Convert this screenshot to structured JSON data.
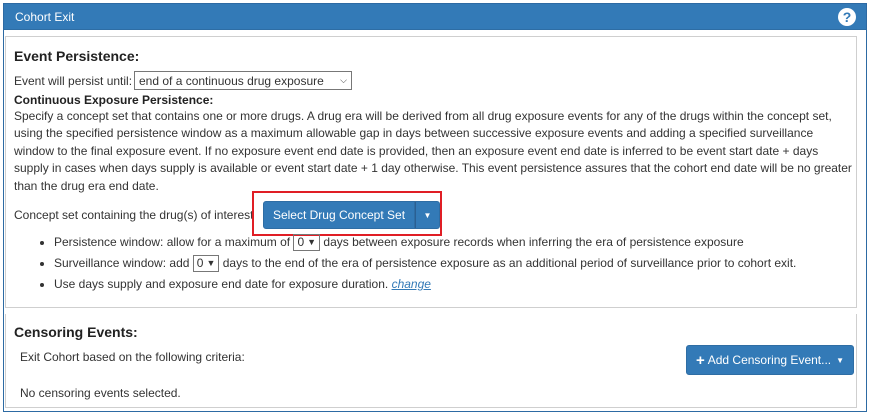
{
  "panel": {
    "title": "Cohort Exit",
    "help_icon": "question-circle-icon"
  },
  "persistence": {
    "heading": "Event Persistence:",
    "persist_label": "Event will persist until:",
    "persist_select": "end of a continuous drug exposure",
    "sub_heading": "Continuous Exposure Persistence:",
    "description": "Specify a concept set that contains one or more drugs. A drug era will be derived from all drug exposure events for any of the drugs within the concept set, using the specified persistence window as a maximum allowable gap in days between successive exposure events and adding a specified surveillance window to the final exposure event. If no exposure event end date is provided, then an exposure event end date is inferred to be event start date + days supply in cases when days supply is available or event start date + 1 day otherwise. This event persistence assures that the cohort end date will be no greater than the drug era end date.",
    "concept_label": "Concept set containing the drug(s) of interest",
    "concept_button": "Select Drug Concept Set",
    "bullets": {
      "persistence_pre": "Persistence window: allow for a maximum of",
      "persistence_value": "0",
      "persistence_post": "days between exposure records when inferring the era of persistence exposure",
      "surveillance_pre": "Surveillance window: add",
      "surveillance_value": "0",
      "surveillance_post": "days to the end of the era of persistence exposure as an additional period of surveillance prior to cohort exit.",
      "days_supply_text": "Use days supply and exposure end date for exposure duration.",
      "change_link": "change"
    }
  },
  "censoring": {
    "heading": "Censoring Events:",
    "criteria_label": "Exit Cohort based on the following criteria:",
    "add_button": "Add Censoring Event...",
    "empty_text": "No censoring events selected."
  },
  "colors": {
    "primary": "#337ab7",
    "highlight": "#e01e25"
  }
}
